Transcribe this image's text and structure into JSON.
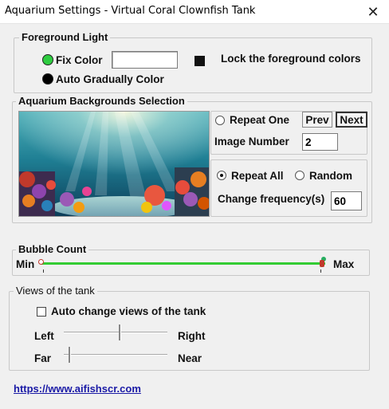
{
  "window": {
    "title": "Aquarium Settings - Virtual Coral Clownfish Tank",
    "close_glyph": "✕"
  },
  "foreground": {
    "legend": "Foreground  Light",
    "fix_color_label": "Fix Color",
    "auto_color_label": "Auto Gradually Color",
    "lock_label": "Lock the foreground colors",
    "fix_color_dot": "#2ecc40",
    "auto_color_dot": "#000000"
  },
  "backgrounds": {
    "legend": "Aquarium Backgrounds Selection",
    "repeat_one_label": "Repeat One",
    "prev_label": "Prev",
    "next_label": "Next",
    "image_number_label": "Image Number",
    "image_number_value": "2",
    "repeat_all_label": "Repeat All",
    "random_label": "Random",
    "change_frequency_label": "Change frequency(s)",
    "change_frequency_value": "60",
    "repeat_all_selected": true
  },
  "bubble": {
    "legend": "Bubble Count",
    "min_label": "Min",
    "max_label": "Max",
    "value_fraction": 1.0,
    "track_color": "#33cc33"
  },
  "views": {
    "legend": "Views of the tank",
    "auto_change_label": "Auto change views of the tank",
    "auto_change_checked": false,
    "left_label": "Left",
    "right_label": "Right",
    "far_label": "Far",
    "near_label": "Near",
    "left_right_fraction": 0.55,
    "far_near_fraction": 0.05
  },
  "footer": {
    "link_text": "https://www.aifishscr.com"
  }
}
